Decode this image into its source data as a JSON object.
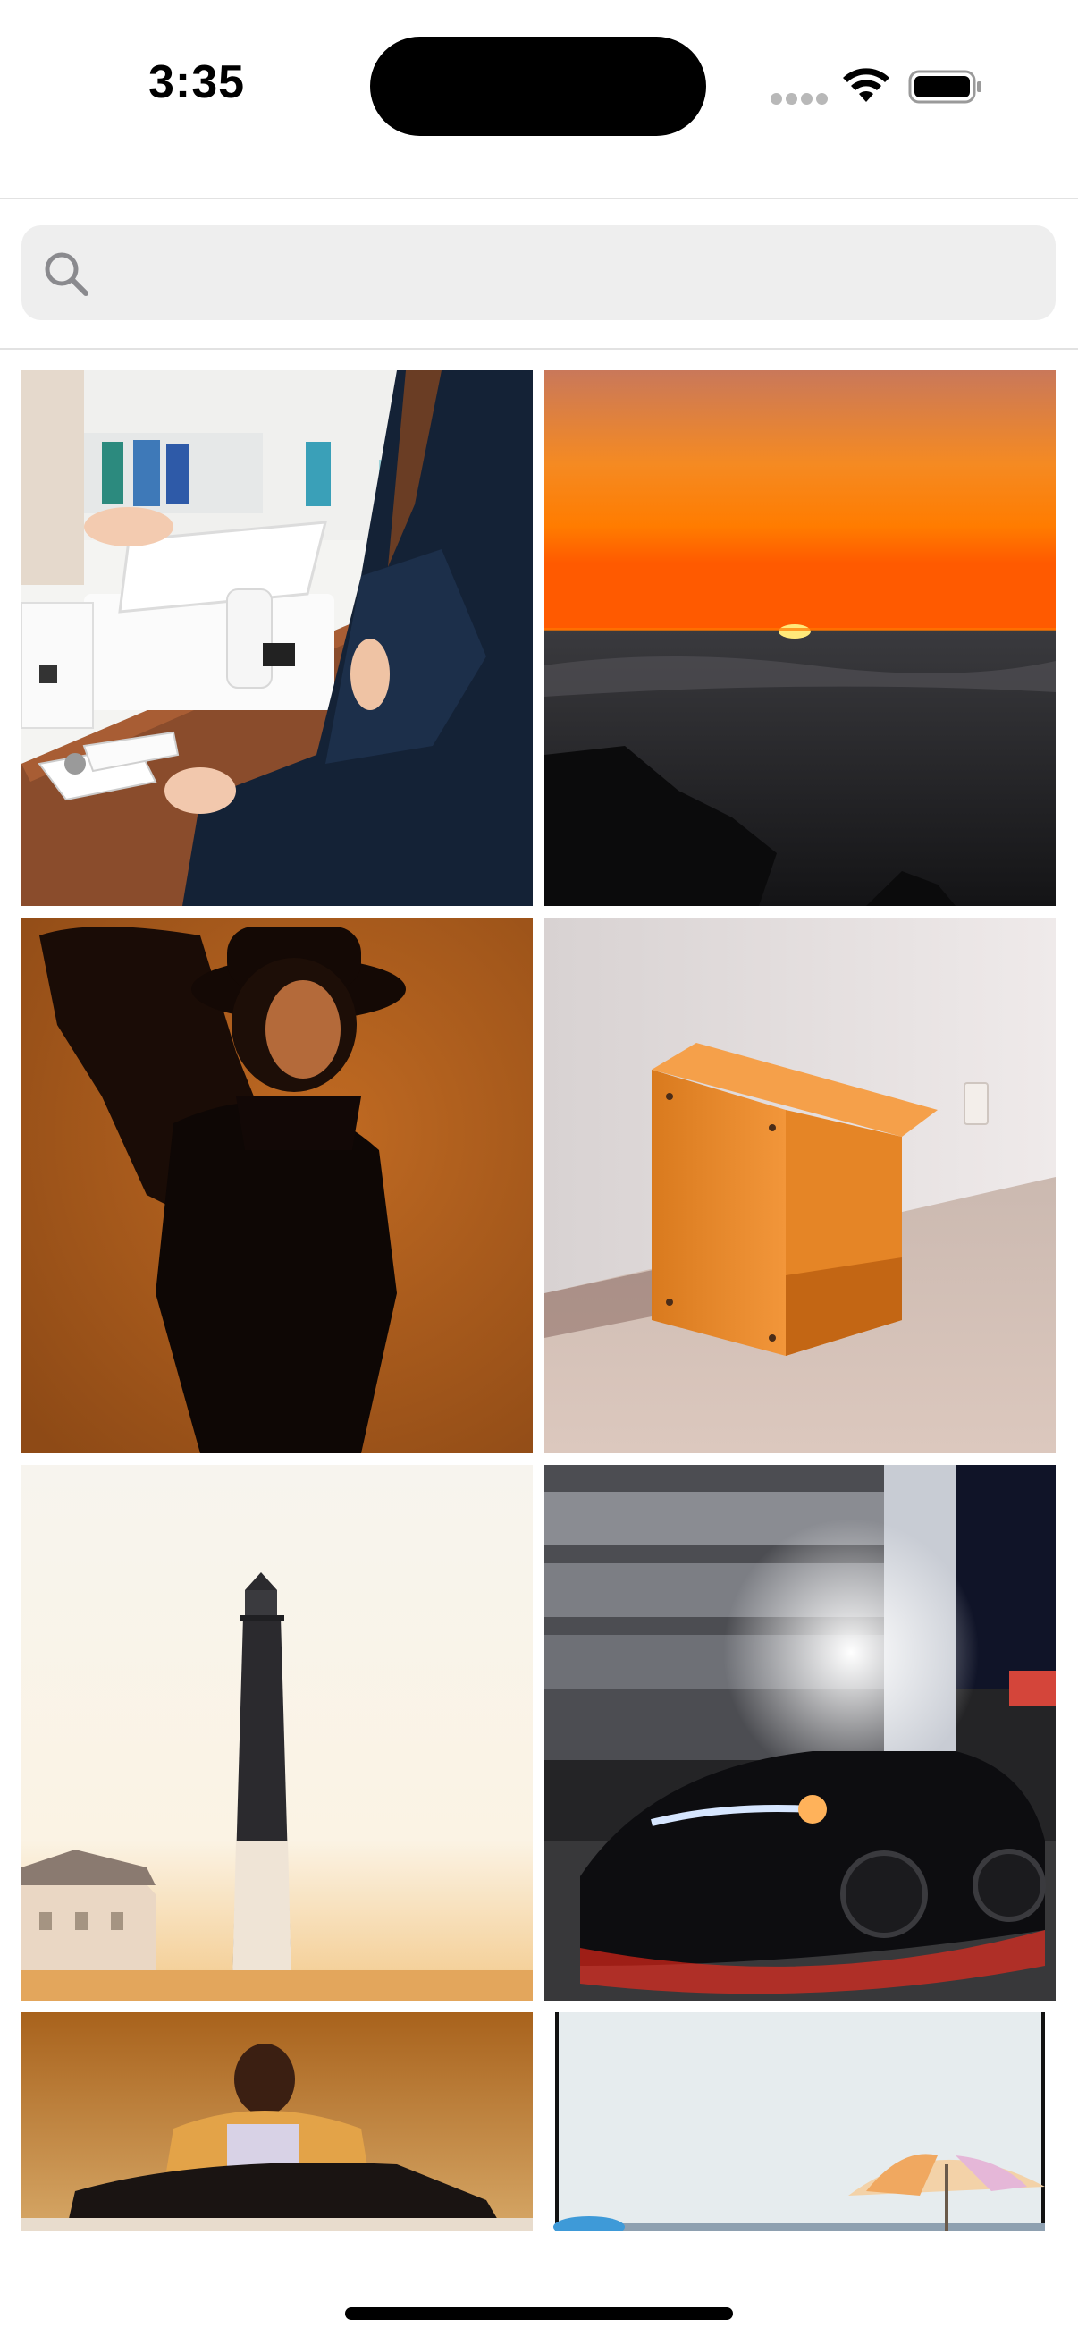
{
  "status_bar": {
    "time": "3:35"
  },
  "search": {
    "placeholder": "",
    "value": "",
    "icon": "search-icon"
  },
  "photos": [
    {
      "description_icon": "photo-tile",
      "accent": "#f2f2f2"
    },
    {
      "description_icon": "photo-tile",
      "accent": "#ff7a00"
    },
    {
      "description_icon": "photo-tile",
      "accent": "#b8621c"
    },
    {
      "description_icon": "photo-tile",
      "accent": "#e9832a"
    },
    {
      "description_icon": "photo-tile",
      "accent": "#f8f1e6"
    },
    {
      "description_icon": "photo-tile",
      "accent": "#1a1a1a"
    },
    {
      "description_icon": "photo-tile",
      "accent": "#b86a22"
    },
    {
      "description_icon": "photo-tile",
      "accent": "#e8eeef"
    }
  ],
  "colors": {
    "background": "#ffffff",
    "search_background": "#eeeeee",
    "divider": "#e2e2e2",
    "text": "#000000"
  }
}
